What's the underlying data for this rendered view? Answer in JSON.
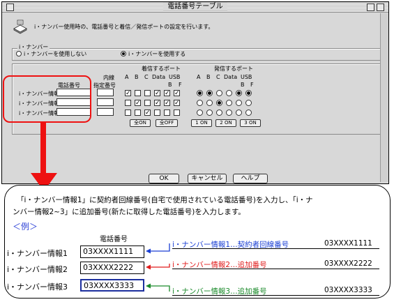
{
  "window": {
    "title": "電話番号テーブル"
  },
  "description": "i・ナンバー使用時の、電話番号と着信／発信ポートの設定を行います。",
  "inumber": {
    "group_label": "i・ナンバー",
    "option_off": "i・ナンバーを使用しない",
    "option_on": "i・ナンバーを使用する",
    "selected": "on"
  },
  "table": {
    "phone_header": "電話番号",
    "internal_header_1": "内線",
    "internal_header_2": "指定番号",
    "incoming_header": "着信するポート",
    "outgoing_header": "発信するポート",
    "port_cols": [
      "A",
      "B",
      "C",
      "Data",
      "USB"
    ],
    "usb_sub": [
      "B",
      "F"
    ],
    "rows": [
      {
        "label": "i・ナンバー情報1",
        "incoming": [
          1,
          0,
          0,
          1,
          1,
          1
        ],
        "outgoing": [
          1,
          1,
          0,
          0,
          1,
          1
        ]
      },
      {
        "label": "i・ナンバー情報2",
        "incoming": [
          0,
          1,
          0,
          1,
          1,
          1
        ],
        "outgoing": [
          0,
          0,
          1,
          0,
          0,
          0
        ]
      },
      {
        "label": "i・ナンバー情報3",
        "incoming": [
          0,
          0,
          1,
          0,
          0,
          0
        ],
        "outgoing": [
          0,
          0,
          0,
          0,
          0,
          0
        ]
      }
    ],
    "all_on": "全ON",
    "all_off": "全OFF",
    "on_buttons": [
      "1 ON",
      "2 ON",
      "3 ON"
    ]
  },
  "buttons": {
    "ok": "OK",
    "cancel": "キャンセル",
    "help": "ヘルプ"
  },
  "callout": {
    "line1": "「i・ナンバー情報1」に契約者回線番号(自宅で使用されている電話番号)を入力し、「i・ナ",
    "line2": "ンバー情報2~3」に追加番号(新たに取得した電話番号)を入力します。",
    "example_title": "＜例＞",
    "column_header": "電話番号",
    "rows": [
      {
        "label": "i・ナンバー情報1",
        "value": "03XXXX1111",
        "note": "i・ナンバー情報1…契約者回線番号",
        "number": "03XXXX1111"
      },
      {
        "label": "i・ナンバー情報2",
        "value": "03XXXX2222",
        "note": "i・ナンバー情報2…追加番号",
        "number": "03XXXX2222"
      },
      {
        "label": "i・ナンバー情報3",
        "value": "03XXXX3333",
        "note": "i・ナンバー情報3…追加番号",
        "number": "03XXXX3333"
      }
    ]
  },
  "colors": {
    "highlight": "#ee1111",
    "row1": "#1a3fd4",
    "row2": "#e01b1b",
    "row3": "#1a8a2a",
    "example": "#2a3fd6"
  }
}
